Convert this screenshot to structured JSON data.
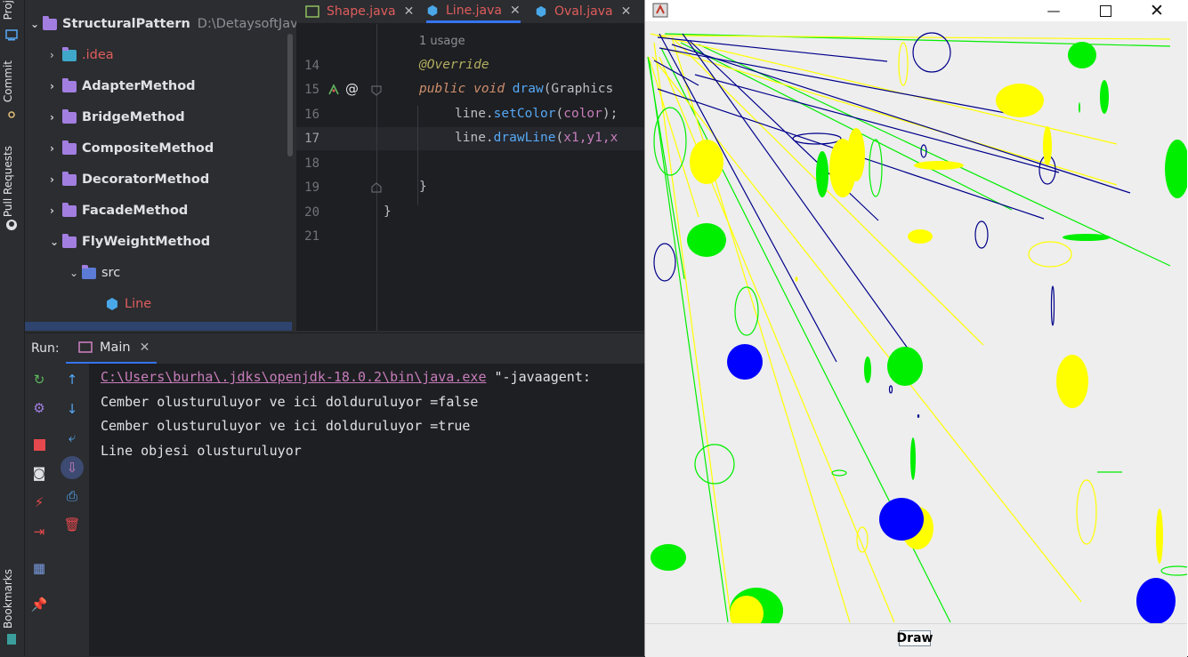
{
  "toolstrip": {
    "project_label": "Proj",
    "commit_label": "Commit",
    "pull_requests_label": "Pull Requests",
    "bookmarks_label": "Bookmarks"
  },
  "project": {
    "root": {
      "name": "StructuralPattern",
      "path": "D:\\DetaysoftJavaPro"
    },
    "items": [
      {
        "label": ".idea"
      },
      {
        "label": "AdapterMethod"
      },
      {
        "label": "BridgeMethod"
      },
      {
        "label": "CompositeMethod"
      },
      {
        "label": "DecoratorMethod"
      },
      {
        "label": "FacadeMethod"
      },
      {
        "label": "FlyWeightMethod"
      },
      {
        "label": "src"
      },
      {
        "label": "Line"
      }
    ]
  },
  "editor": {
    "tabs": [
      {
        "label": "Shape.java",
        "color": "#e05c5c"
      },
      {
        "label": "Line.java",
        "color": "#e05c5c"
      },
      {
        "label": "Oval.java",
        "color": "#e05c5c"
      }
    ],
    "usage_hint": "1 usage",
    "line_numbers": [
      "14",
      "15",
      "16",
      "17",
      "18",
      "19",
      "20",
      "21"
    ],
    "code": {
      "l14": "@Override",
      "l15_kw1": "public",
      "l15_kw2": "void",
      "l15_fn": "draw",
      "l15_rest": "(Graphics",
      "l16_obj": "line",
      "l16_method": "setColor",
      "l16_arg": "color",
      "l16_end": ");",
      "l17_obj": "line",
      "l17_method": "drawLine",
      "l17_args": "x1,y1,x",
      "l19": "}",
      "l20": "}"
    }
  },
  "run": {
    "label": "Run:",
    "tab": "Main",
    "console": [
      {
        "link": "C:\\Users\\burha\\.jdks\\openjdk-18.0.2\\bin\\java.exe",
        "rest": " \"-javaagent:"
      },
      {
        "text": "Cember olusturuluyor ve ici dolduruluyor =false"
      },
      {
        "text": "Cember olusturuluyor ve ici dolduruluyor =true"
      },
      {
        "text": "Line objesi olusturuluyor"
      }
    ]
  },
  "app": {
    "draw_button": "Draw",
    "colors": {
      "green": "#00ee00",
      "yellow": "#ffff00",
      "blue": "#0000ff",
      "navy": "#00008b"
    }
  }
}
